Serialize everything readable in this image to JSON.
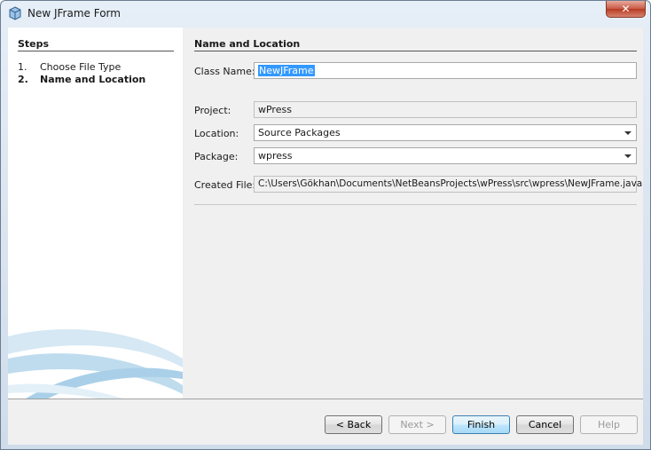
{
  "window": {
    "title": "New JFrame Form",
    "close_glyph": "✕"
  },
  "steps": {
    "heading": "Steps",
    "items": [
      {
        "number": "1.",
        "label": "Choose File Type",
        "current": false
      },
      {
        "number": "2.",
        "label": "Name and Location",
        "current": true
      }
    ]
  },
  "panel": {
    "heading": "Name and Location",
    "class_name": {
      "label": "Class Name:",
      "value": "NewJFrame"
    },
    "project": {
      "label": "Project:",
      "value": "wPress"
    },
    "location": {
      "label": "Location:",
      "value": "Source Packages"
    },
    "package": {
      "label": "Package:",
      "value": "wpress"
    },
    "created_file": {
      "label": "Created File:",
      "value": "C:\\Users\\Gökhan\\Documents\\NetBeansProjects\\wPress\\src\\wpress\\NewJFrame.java"
    }
  },
  "buttons": {
    "back": "< Back",
    "next": "Next >",
    "finish": "Finish",
    "cancel": "Cancel",
    "help": "Help"
  },
  "icons": {
    "app": "netbeans-cube-icon",
    "close": "close-icon",
    "dropdown": "chevron-down-icon"
  }
}
